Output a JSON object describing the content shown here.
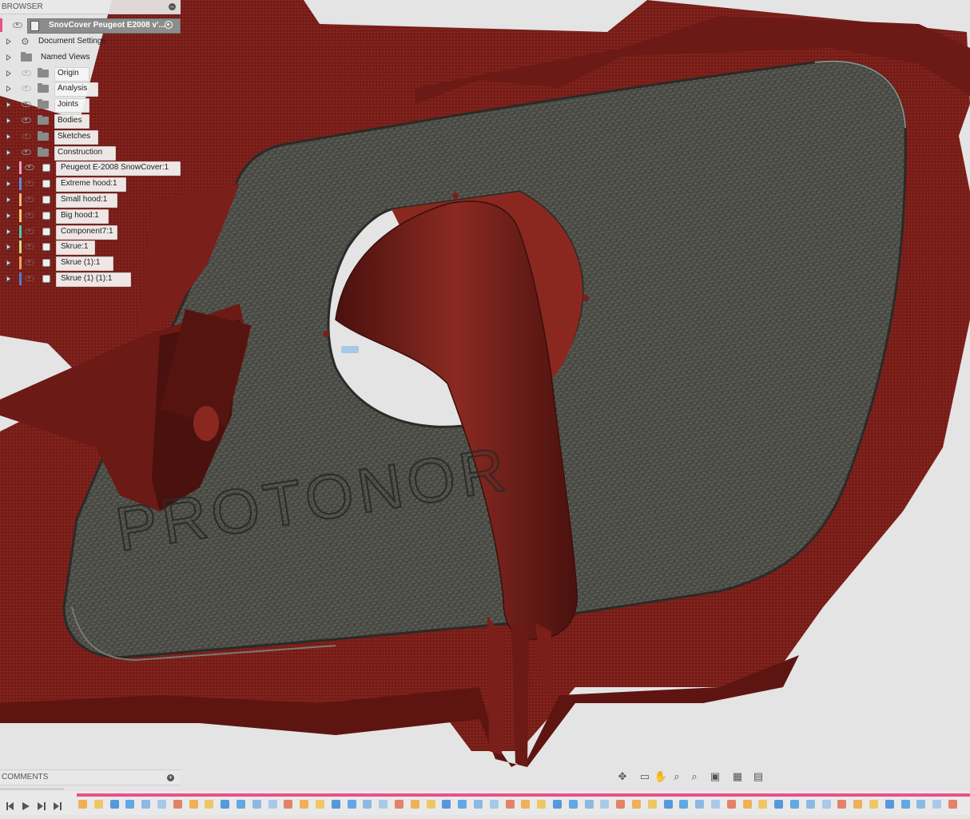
{
  "browser": {
    "title": "BROWSER",
    "collapse_icon": "minus-circle-icon",
    "root": {
      "label": "SnovCover Peugeot E2008 v'..."
    },
    "items": [
      {
        "label": "Document Settings",
        "icon": "gear-icon",
        "eye": false,
        "color": ""
      },
      {
        "label": "Named Views",
        "icon": "folder-icon",
        "eye": false,
        "color": ""
      },
      {
        "label": "Origin",
        "icon": "folder-icon",
        "eye": "off",
        "color": ""
      },
      {
        "label": "Analysis",
        "icon": "folder-icon",
        "eye": "off",
        "color": ""
      },
      {
        "label": "Joints",
        "icon": "folder-icon",
        "eye": "on",
        "color": ""
      },
      {
        "label": "Bodies",
        "icon": "folder-icon",
        "eye": "on",
        "color": ""
      },
      {
        "label": "Sketches",
        "icon": "folder-icon",
        "eye": "off",
        "color": ""
      },
      {
        "label": "Construction",
        "icon": "folder-icon",
        "eye": "on",
        "color": ""
      },
      {
        "label": "Peugeot E-2008 SnowCover:1",
        "icon": "component-icon",
        "eye": "on",
        "color": "#f29fc4"
      },
      {
        "label": "Extreme hood:1",
        "icon": "component-icon",
        "eye": "off",
        "color": "#5b8fd6"
      },
      {
        "label": "Small hood:1",
        "icon": "component-icon",
        "eye": "off",
        "color": "#f2b67a"
      },
      {
        "label": "Big hood:1",
        "icon": "component-icon",
        "eye": "off",
        "color": "#f5c96e"
      },
      {
        "label": "Component7:1",
        "icon": "component-icon",
        "eye": "off",
        "color": "#55c9b4"
      },
      {
        "label": "Skrue:1",
        "icon": "component-icon",
        "eye": "off",
        "color": "#cfe07a"
      },
      {
        "label": "Skrue (1):1",
        "icon": "component-icon",
        "eye": "off",
        "color": "#f2a05a"
      },
      {
        "label": "Skrue (1) (1):1",
        "icon": "component-icon",
        "eye": "off",
        "color": "#4f7fd0"
      }
    ]
  },
  "canvas": {
    "engraved_text": "PROTONOR",
    "body_color": "#7a1f1a",
    "panel_color": "#4d4d47"
  },
  "comments": {
    "title": "COMMENTS",
    "add_icon": "plus-circle-icon"
  },
  "navbar": {
    "tools": [
      "orbit-icon",
      "look-at-icon",
      "pan-icon",
      "zoom-icon",
      "fit-icon",
      "display-settings-icon",
      "visual-style-icon",
      "grid-icon"
    ]
  },
  "timeline": {
    "controls": [
      "go-to-start-icon",
      "step-back-icon",
      "play-icon",
      "step-forward-icon",
      "go-to-end-icon"
    ],
    "accent": "#e9508c"
  }
}
